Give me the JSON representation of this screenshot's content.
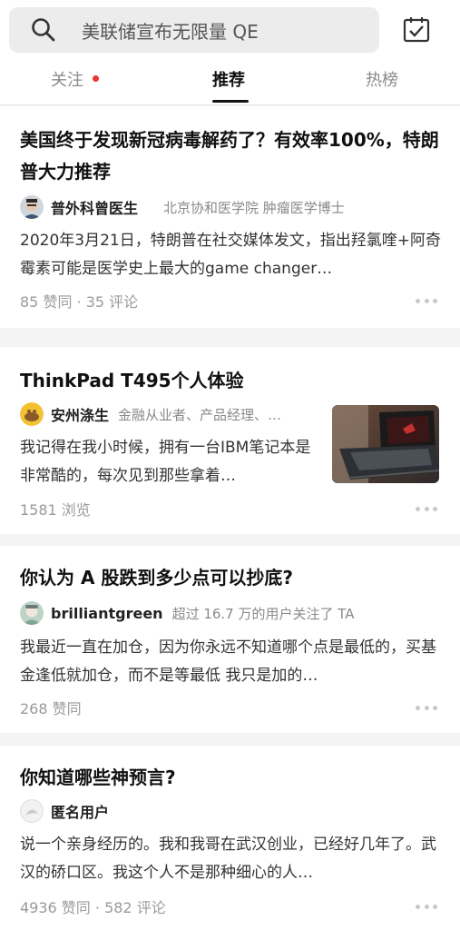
{
  "search": {
    "placeholder": "美联储宣布无限量 QE"
  },
  "tabs": [
    {
      "label": "关注"
    },
    {
      "label": "推荐"
    },
    {
      "label": "热榜"
    }
  ],
  "feed": [
    {
      "title": "美国终于发现新冠病毒解药了？有效率100%，特朗普大力推荐",
      "author": "普外科曾医生",
      "author_desc": "北京协和医学院 肿瘤医学博士",
      "excerpt": "2020年3月21日，特朗普在社交媒体发文，指出羟氯喹+阿奇霉素可能是医学史上最大的game changer…",
      "meta": "85 赞同 · 35 评论"
    },
    {
      "title": "ThinkPad T495个人体验",
      "author": "安州涤生",
      "author_desc": "金融从业者、产品经理、…",
      "excerpt": "我记得在我小时候，拥有一台IBM笔记本是非常酷的，每次见到那些拿着…",
      "meta": "1581 浏览"
    },
    {
      "title": "你认为 A 股跌到多少点可以抄底?",
      "author": "brilliantgreen",
      "author_desc": "超过 16.7 万的用户关注了 TA",
      "excerpt": "我最近一直在加仓，因为你永远不知道哪个点是最低的，买基金逢低就加仓，而不是等最低 我只是加的…",
      "meta": "268 赞同"
    },
    {
      "title": "你知道哪些神预言?",
      "author": "匿名用户",
      "author_desc": "",
      "excerpt": "说一个亲身经历的。我和我哥在武汉创业，已经好几年了。武汉的硚口区。我这个人不是那种细心的人…",
      "meta": "4936 赞同 · 582 评论"
    }
  ],
  "colors": {
    "notification_dot": "#e33333",
    "accent": "#111111"
  }
}
